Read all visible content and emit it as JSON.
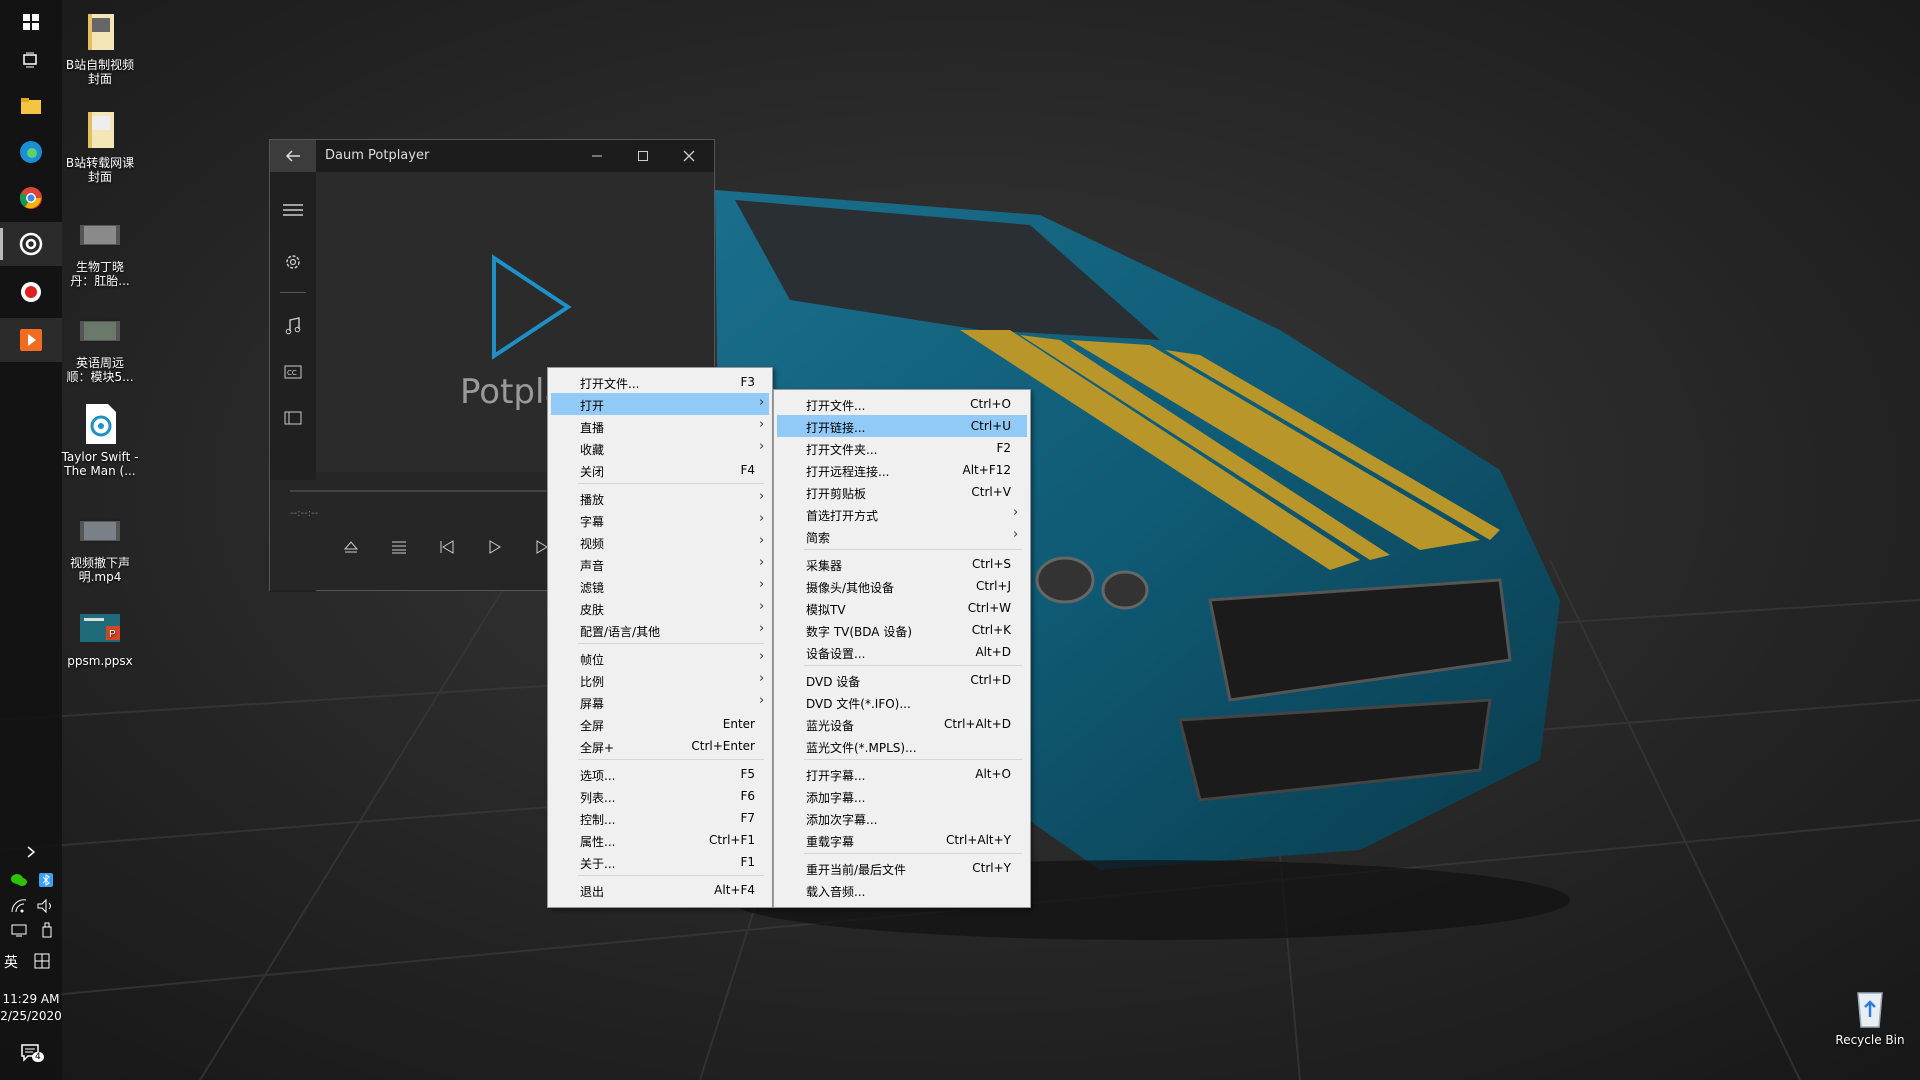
{
  "desktop": {
    "icons": [
      {
        "label": "B站自制视频\n封面",
        "icon": "folder-icon"
      },
      {
        "label": "B站转载网课\n封面",
        "icon": "folder-icon"
      },
      {
        "label": "生物丁晓\n丹：肛胎...",
        "icon": "video-thumb-icon"
      },
      {
        "label": "英语周远\n顺：模块5...",
        "icon": "video-thumb-icon"
      },
      {
        "label": "Taylor Swift -\nThe Man (...",
        "icon": "media-file-icon"
      },
      {
        "label": "视频撤下声\n明.mp4",
        "icon": "video-thumb-icon"
      },
      {
        "label": "ppsm.ppsx",
        "icon": "powerpoint-file-icon"
      }
    ],
    "recycle_bin": "Recycle Bin"
  },
  "taskbar": {
    "clock_time": "11:29 AM",
    "clock_date": "2/25/2020",
    "ime_lang": "英",
    "notification_count": "4"
  },
  "player": {
    "title": "Daum Potplayer",
    "logo_text": "Potpla",
    "time_text": "--:--:--",
    "colors": {
      "play_logo": "#1e90c8",
      "accent": "#91c9f7"
    }
  },
  "main_menu": {
    "items": [
      {
        "label": "打开文件...",
        "shortcut": "F3"
      },
      {
        "label": "打开",
        "submenu": true,
        "highlighted": true
      },
      {
        "label": "直播",
        "submenu": true
      },
      {
        "label": "收藏",
        "submenu": true
      },
      {
        "label": "关闭",
        "shortcut": "F4"
      },
      {
        "label": "播放",
        "submenu": true
      },
      {
        "label": "字幕",
        "submenu": true
      },
      {
        "label": "视频",
        "submenu": true
      },
      {
        "label": "声音",
        "submenu": true
      },
      {
        "label": "滤镜",
        "submenu": true
      },
      {
        "label": "皮肤",
        "submenu": true
      },
      {
        "label": "配置/语言/其他",
        "submenu": true
      },
      {
        "label": "帧位",
        "submenu": true
      },
      {
        "label": "比例",
        "submenu": true
      },
      {
        "label": "屏幕",
        "submenu": true
      },
      {
        "label": "全屏",
        "shortcut": "Enter"
      },
      {
        "label": "全屏+",
        "shortcut": "Ctrl+Enter"
      },
      {
        "label": "选项...",
        "shortcut": "F5"
      },
      {
        "label": "列表...",
        "shortcut": "F6"
      },
      {
        "label": "控制...",
        "shortcut": "F7"
      },
      {
        "label": "属性...",
        "shortcut": "Ctrl+F1"
      },
      {
        "label": "关于...",
        "shortcut": "F1"
      },
      {
        "label": "退出",
        "shortcut": "Alt+F4"
      }
    ]
  },
  "open_submenu": {
    "items": [
      {
        "label": "打开文件...",
        "shortcut": "Ctrl+O"
      },
      {
        "label": "打开链接...",
        "shortcut": "Ctrl+U",
        "highlighted": true
      },
      {
        "label": "打开文件夹...",
        "shortcut": "F2"
      },
      {
        "label": "打开远程连接...",
        "shortcut": "Alt+F12"
      },
      {
        "label": "打开剪贴板",
        "shortcut": "Ctrl+V"
      },
      {
        "label": "首选打开方式",
        "submenu": true
      },
      {
        "label": "简索",
        "submenu": true
      },
      {
        "label": "采集器",
        "shortcut": "Ctrl+S"
      },
      {
        "label": "摄像头/其他设备",
        "shortcut": "Ctrl+J"
      },
      {
        "label": "模拟TV",
        "shortcut": "Ctrl+W"
      },
      {
        "label": "数字 TV(BDA 设备)",
        "shortcut": "Ctrl+K"
      },
      {
        "label": "设备设置...",
        "shortcut": "Alt+D"
      },
      {
        "label": "DVD 设备",
        "shortcut": "Ctrl+D"
      },
      {
        "label": "DVD 文件(*.IFO)...",
        "shortcut": ""
      },
      {
        "label": "蓝光设备",
        "shortcut": "Ctrl+Alt+D"
      },
      {
        "label": "蓝光文件(*.MPLS)...",
        "shortcut": ""
      },
      {
        "label": "打开字幕...",
        "shortcut": "Alt+O"
      },
      {
        "label": "添加字幕...",
        "shortcut": ""
      },
      {
        "label": "添加次字幕...",
        "shortcut": ""
      },
      {
        "label": "重载字幕",
        "shortcut": "Ctrl+Alt+Y"
      },
      {
        "label": "重开当前/最后文件",
        "shortcut": "Ctrl+Y"
      },
      {
        "label": "载入音频...",
        "shortcut": ""
      }
    ]
  }
}
